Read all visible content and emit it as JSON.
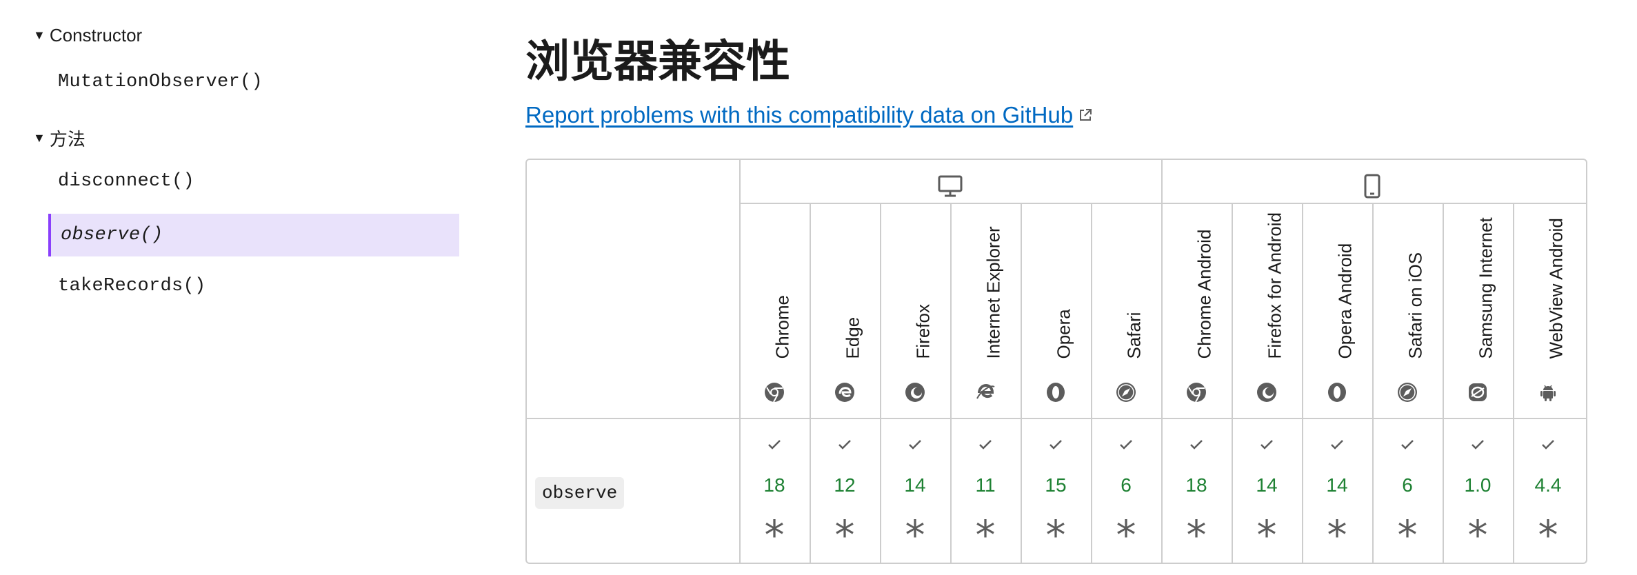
{
  "sidebar": {
    "sections": [
      {
        "title": "Constructor",
        "items": [
          {
            "label": "MutationObserver()"
          }
        ]
      },
      {
        "title": "方法",
        "items": [
          {
            "label": "disconnect()"
          },
          {
            "label": "observe()",
            "active": true
          },
          {
            "label": "takeRecords()"
          }
        ]
      }
    ]
  },
  "main": {
    "title": "浏览器兼容性",
    "report_link": "Report problems with this compatibility data on GitHub"
  },
  "compat": {
    "platforms": [
      {
        "name": "desktop",
        "icon": "desktop-icon"
      },
      {
        "name": "mobile",
        "icon": "mobile-icon"
      }
    ],
    "browsers": [
      {
        "name": "Chrome",
        "icon": "chrome-icon"
      },
      {
        "name": "Edge",
        "icon": "edge-icon"
      },
      {
        "name": "Firefox",
        "icon": "firefox-icon"
      },
      {
        "name": "Internet Explorer",
        "icon": "internet-explorer-icon"
      },
      {
        "name": "Opera",
        "icon": "opera-icon"
      },
      {
        "name": "Safari",
        "icon": "safari-icon"
      },
      {
        "name": "Chrome Android",
        "icon": "chrome-icon"
      },
      {
        "name": "Firefox for Android",
        "icon": "firefox-icon"
      },
      {
        "name": "Opera Android",
        "icon": "opera-icon"
      },
      {
        "name": "Safari on iOS",
        "icon": "safari-icon"
      },
      {
        "name": "Samsung Internet",
        "icon": "samsung-internet-icon"
      },
      {
        "name": "WebView Android",
        "icon": "android-icon"
      }
    ],
    "rows": [
      {
        "feature": "observe",
        "cells": [
          {
            "version": "18",
            "supported": true,
            "note": "*"
          },
          {
            "version": "12",
            "supported": true,
            "note": "*"
          },
          {
            "version": "14",
            "supported": true,
            "note": "*"
          },
          {
            "version": "11",
            "supported": true,
            "note": "*"
          },
          {
            "version": "15",
            "supported": true,
            "note": "*"
          },
          {
            "version": "6",
            "supported": true,
            "note": "*"
          },
          {
            "version": "18",
            "supported": true,
            "note": "*"
          },
          {
            "version": "14",
            "supported": true,
            "note": "*"
          },
          {
            "version": "14",
            "supported": true,
            "note": "*"
          },
          {
            "version": "6",
            "supported": true,
            "note": "*"
          },
          {
            "version": "1.0",
            "supported": true,
            "note": "*"
          },
          {
            "version": "4.4",
            "supported": true,
            "note": "*"
          }
        ]
      }
    ]
  },
  "colors": {
    "supported": "#1e8133",
    "link": "#0069c2",
    "active_bg": "#e9e2fb",
    "active_border": "#8a3ffc"
  }
}
